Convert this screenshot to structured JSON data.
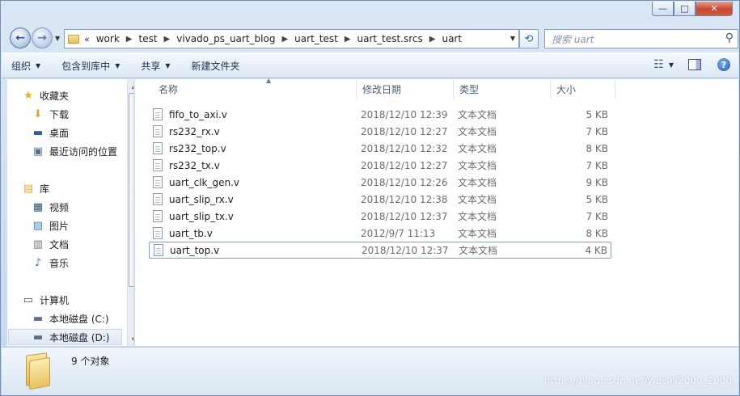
{
  "window": {
    "minimize": "—",
    "maximize": "□",
    "close": "✕"
  },
  "address": {
    "lead": "«",
    "crumbs": [
      "work",
      "test",
      "vivado_ps_uart_blog",
      "uart_test",
      "uart_test.srcs",
      "uart"
    ],
    "search_placeholder": "搜索 uart"
  },
  "toolbar": {
    "organize": "组织",
    "include_in_library": "包含到库中",
    "share": "共享",
    "new_folder": "新建文件夹"
  },
  "navigation": {
    "favorites": "收藏夹",
    "downloads": "下载",
    "desktop": "桌面",
    "recent_places": "最近访问的位置",
    "libraries": "库",
    "videos": "视频",
    "pictures": "图片",
    "documents": "文档",
    "music": "音乐",
    "computer": "计算机",
    "drive_c": "本地磁盘 (C:)",
    "drive_d": "本地磁盘 (D:)"
  },
  "columns": {
    "name": "名称",
    "date_modified": "修改日期",
    "type": "类型",
    "size": "大小"
  },
  "files": [
    {
      "name": "fifo_to_axi.v",
      "date": "2018/12/10 12:39",
      "type": "文本文档",
      "size": "5 KB"
    },
    {
      "name": "rs232_rx.v",
      "date": "2018/12/10 12:27",
      "type": "文本文档",
      "size": "7 KB"
    },
    {
      "name": "rs232_top.v",
      "date": "2018/12/10 12:32",
      "type": "文本文档",
      "size": "8 KB"
    },
    {
      "name": "rs232_tx.v",
      "date": "2018/12/10 12:27",
      "type": "文本文档",
      "size": "7 KB"
    },
    {
      "name": "uart_clk_gen.v",
      "date": "2018/12/10 12:26",
      "type": "文本文档",
      "size": "9 KB"
    },
    {
      "name": "uart_slip_rx.v",
      "date": "2018/12/10 12:38",
      "type": "文本文档",
      "size": "5 KB"
    },
    {
      "name": "uart_slip_tx.v",
      "date": "2018/12/10 12:37",
      "type": "文本文档",
      "size": "7 KB"
    },
    {
      "name": "uart_tb.v",
      "date": "2012/9/7 11:13",
      "type": "文本文档",
      "size": "8 KB"
    },
    {
      "name": "uart_top.v",
      "date": "2018/12/10 12:37",
      "type": "文本文档",
      "size": "4 KB"
    }
  ],
  "status": {
    "item_count": "9 个对象"
  },
  "watermark": "https://blog.csdn.net/weisili2000_2000"
}
